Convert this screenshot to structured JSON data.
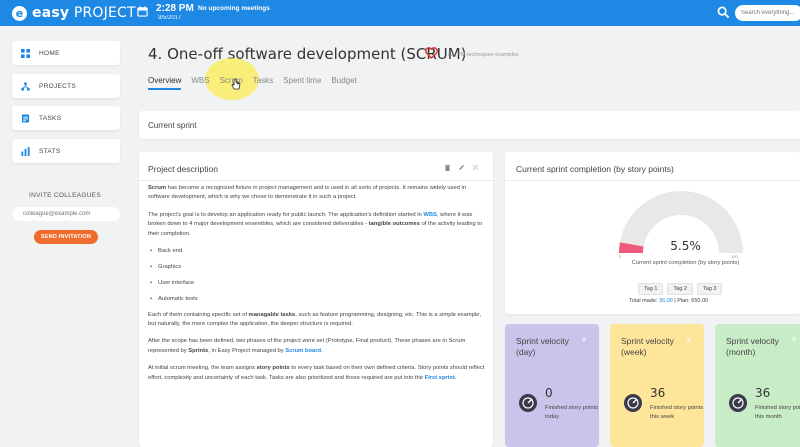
{
  "topbar": {
    "logo_mark": "e",
    "logo_word_bold": "easy",
    "logo_word": " PROJECT",
    "time": "2:28 PM",
    "date": "9/5/2017",
    "meetings": "No upcoming meetings",
    "search_placeholder": "Search everything..."
  },
  "sidebar": {
    "items": [
      {
        "label": "HOME",
        "icon": "grid-icon"
      },
      {
        "label": "PROJECTS",
        "icon": "network-icon"
      },
      {
        "label": "TASKS",
        "icon": "clipboard-icon"
      },
      {
        "label": "STATS",
        "icon": "bar-chart-icon"
      }
    ],
    "invite_label": "INVITE COLLEAGUES",
    "invite_placeholder": "colleague@example.com",
    "send_label": "SEND INVITATION"
  },
  "header": {
    "title": "4. One-off software development (SCRUM)",
    "breadcrumb": "/ 2. PM techniques examples",
    "tabs": [
      "Overview",
      "WBS",
      "Scrum",
      "Tasks",
      "Spent time",
      "Budget"
    ],
    "active_tab": "Overview"
  },
  "current_sprint": {
    "label": "Current sprint"
  },
  "description": {
    "title": "Project description",
    "p1_bold": "Scrum",
    "p1": " has become a recognized fixture in project management and is used in all sorts of projects. It remains widely used in software development, which is why we chose to demonstrate it in such a project.",
    "p2a": "The project's goal is to develop an application ready for public launch. The application's definition started in ",
    "p2_link": "WBS",
    "p2b": ", where it was broken down to 4 major development ensembles, which are considered deliverables - ",
    "p2_bold": "tangible outcomes",
    "p2c": " of the activity leading to their completion.",
    "bullets": [
      "Back end",
      "Graphics",
      "User interface",
      "Automatic tests"
    ],
    "p3a": "Each of them containing specific set of ",
    "p3_bold": "managable tasks",
    "p3b": ", such as feature programming, designing, etc. This is a simple example, but naturally, the more complex the application, the deeper structure is required.",
    "p4a": "After the scope has been defined, two phases of the project were set (Prototype, Final product). These phases are in Scrum represented by ",
    "p4_bold": "Sprints",
    "p4b": ", in Easy Project managed by ",
    "p4_link": "Scrum board",
    "p4c": ".",
    "p5a": "At initial scrum meeting, the team assigns ",
    "p5_bold": "story points",
    "p5b": " to every task based on their own defined criteria. Story points should reflect effort, complexity and uncertainty of each task. Tasks are also prioritized and those required are put into the ",
    "p5_link": "First sprint",
    "p5c": "."
  },
  "completion": {
    "title": "Current sprint completion (by story points)",
    "percent_text": "5.5%",
    "percent_value": 5.5,
    "gauge_min": "0",
    "gauge_max": "100",
    "gauge_label": "Current sprint completion (by story points)",
    "tags": [
      "Tag 1",
      "Tag 2",
      "Tag 3"
    ],
    "total_label": "Total made: ",
    "total_value": "36.00",
    "plan_label": " | Plan: 650.00",
    "gauge_fill_color": "#ef5a7a",
    "gauge_track_color": "#e8e8e8"
  },
  "velocity": [
    {
      "title": "Sprint velocity (day)",
      "value": "0",
      "sub": "Finished story points today",
      "color": "#c9c5ea"
    },
    {
      "title": "Sprint velocity (week)",
      "value": "36",
      "sub": "Finished story points this week",
      "color": "#fde69a"
    },
    {
      "title": "Sprint velocity (month)",
      "value": "36",
      "sub": "Finished story points this month",
      "color": "#c8ecc6"
    }
  ]
}
